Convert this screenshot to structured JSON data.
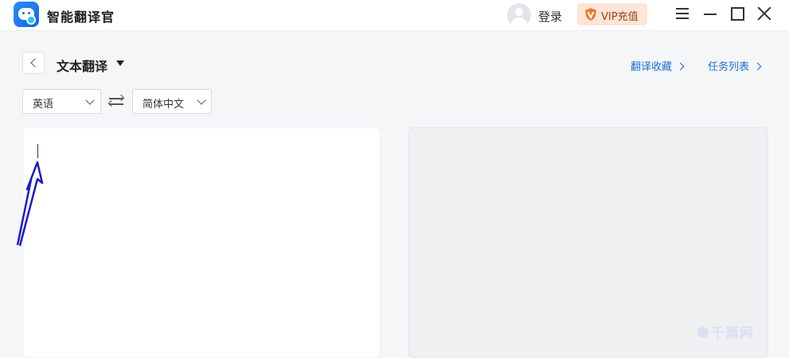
{
  "app": {
    "title": "智能翻译官"
  },
  "header": {
    "login_label": "登录",
    "vip_label": "VIP充值"
  },
  "window_controls": {
    "menu": "hamburger-icon",
    "minimize": "minimize-icon",
    "maximize": "maximize-icon",
    "close": "close-icon"
  },
  "toolbar": {
    "mode_title": "文本翻译",
    "favorites_link": "翻译收藏",
    "tasks_link": "任务列表"
  },
  "languages": {
    "source": "英语",
    "target": "简体中文",
    "swap_icon": "swap-arrows-icon"
  },
  "source_panel": {
    "text": ""
  },
  "target_panel": {
    "text": ""
  },
  "watermark": {
    "text": "千篇网"
  },
  "colors": {
    "accent": "#1e6fd9",
    "vip_bg": "#fde5d8",
    "vip_text": "#a3410e",
    "annotation_arrow": "#1a1acc"
  }
}
